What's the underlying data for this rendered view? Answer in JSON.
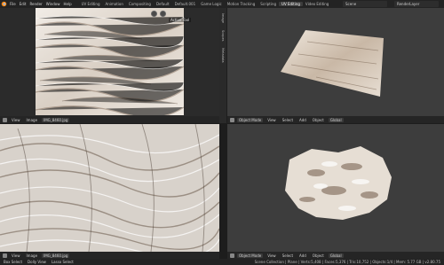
{
  "topbar": {
    "menus": [
      "File",
      "Edit",
      "Render",
      "Window",
      "Help"
    ],
    "workspaces": [
      "UV Editing",
      "Animation",
      "Compositing",
      "Default",
      "Default.001",
      "Game Logic",
      "Motion Tracking",
      "Scripting",
      "UV Editing",
      "Video Editing"
    ],
    "active_workspace_index": 8,
    "scene": "Scene",
    "render_layer": "RenderLayer"
  },
  "img_editor_top": {
    "view": "View",
    "image_menu": "Image",
    "active_tool": "Active Tool",
    "side_tabs": [
      "Image",
      "Scopes",
      "Metadata"
    ]
  },
  "img_editor_top_header": {
    "view": "View",
    "image": "Image",
    "filename": "IMG_8460.jpg"
  },
  "img_editor_bottom_header": {
    "view": "View",
    "image": "Image",
    "filename": "IMG_8460.jpg"
  },
  "viewport_top_header": {
    "mode": "Object Mode",
    "view": "View",
    "select": "Select",
    "add": "Add",
    "object": "Object",
    "orientation": "Global"
  },
  "viewport_bottom_header": {
    "mode": "Object Mode",
    "view": "View",
    "select": "Select",
    "add": "Add",
    "object": "Object",
    "orientation": "Global"
  },
  "statusbar": {
    "left1": "Box Select",
    "left2": "Dolly View",
    "left3": "Lasso Select",
    "right": "Scene Collection | Plane | Verts:5,408 | Faces:5,376 | Tris:10,752 | Objects:1/4 | Mem: 5.77 GB | v2.80.75"
  },
  "colors": {
    "fur_light": "#e9e3dc",
    "fur_dark": "#6a5746",
    "viewport_bg": "#3d3d3d",
    "header_bg": "#252525"
  }
}
